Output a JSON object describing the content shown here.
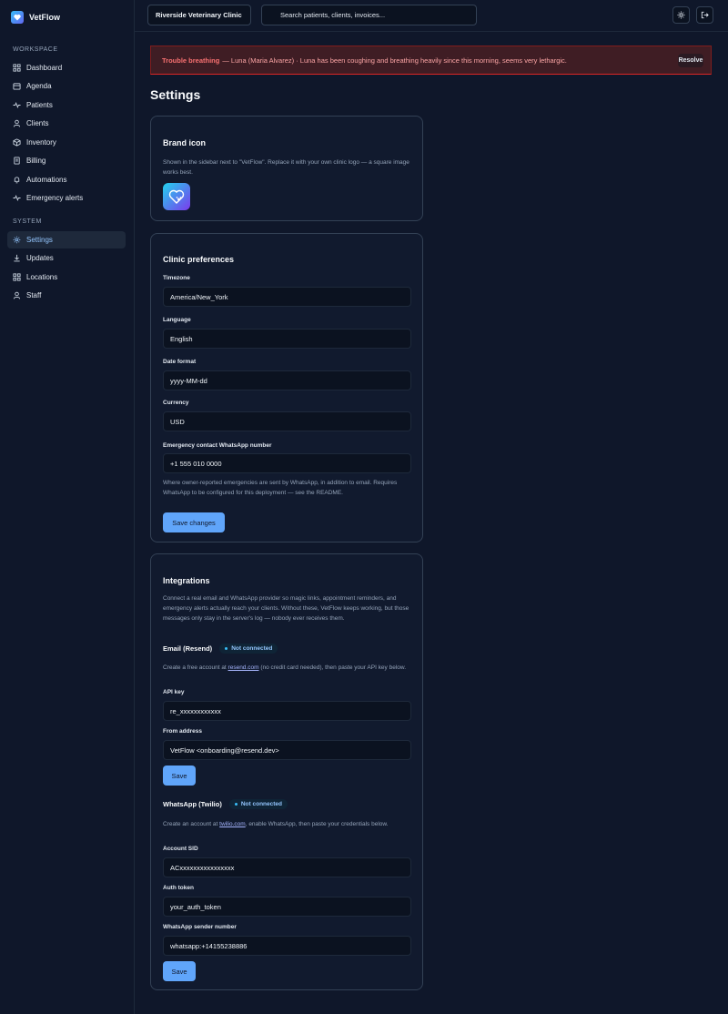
{
  "app": {
    "name": "VetFlow"
  },
  "sidebar": {
    "workspace_label": "WORKSPACE",
    "system_label": "SYSTEM",
    "workspace_items": [
      {
        "label": "Dashboard",
        "icon": "grid-icon"
      },
      {
        "label": "Agenda",
        "icon": "calendar-icon"
      },
      {
        "label": "Patients",
        "icon": "pulse-icon"
      },
      {
        "label": "Clients",
        "icon": "user-icon"
      },
      {
        "label": "Inventory",
        "icon": "box-icon"
      },
      {
        "label": "Billing",
        "icon": "receipt-icon"
      },
      {
        "label": "Automations",
        "icon": "bell-icon"
      },
      {
        "label": "Emergency alerts",
        "icon": "pulse-icon"
      }
    ],
    "system_items": [
      {
        "label": "Settings",
        "icon": "gear-icon",
        "active": true
      },
      {
        "label": "Updates",
        "icon": "download-icon"
      },
      {
        "label": "Locations",
        "icon": "grid-icon"
      },
      {
        "label": "Staff",
        "icon": "user-icon"
      }
    ]
  },
  "topbar": {
    "clinic": "Riverside Veterinary Clinic",
    "search_placeholder": "Search patients, clients, invoices..."
  },
  "alert": {
    "title": "Trouble breathing",
    "message": "— Luna (Maria Alvarez) · Luna has been coughing and breathing heavily since this morning, seems very lethargic.",
    "resolve_label": "Resolve"
  },
  "page": {
    "title": "Settings"
  },
  "brand_icon": {
    "title": "Brand icon",
    "description": "Shown in the sidebar next to \"VetFlow\". Replace it with your own clinic logo — a square image works best."
  },
  "clinic_prefs": {
    "title": "Clinic preferences",
    "timezone_label": "Timezone",
    "timezone_value": "America/New_York",
    "language_label": "Language",
    "language_value": "English",
    "date_format_label": "Date format",
    "date_format_value": "yyyy-MM-dd",
    "currency_label": "Currency",
    "currency_value": "USD",
    "whatsapp_label": "Emergency contact WhatsApp number",
    "whatsapp_value": "+1 555 010 0000",
    "whatsapp_help": "Where owner-reported emergencies are sent by WhatsApp, in addition to email. Requires WhatsApp to be configured for this deployment — see the README.",
    "save_label": "Save changes"
  },
  "integrations": {
    "title": "Integrations",
    "description": "Connect a real email and WhatsApp provider so magic links, appointment reminders, and emergency alerts actually reach your clients. Without these, VetFlow keeps working, but those messages only stay in the server's log — nobody ever receives them.",
    "email": {
      "name": "Email (Resend)",
      "status": "Not connected",
      "help_prefix": "Create a free account at ",
      "help_link": "resend.com",
      "help_suffix": " (no credit card needed), then paste your API key below.",
      "api_key_label": "API key",
      "api_key_value": "re_xxxxxxxxxxxx",
      "from_label": "From address",
      "from_value": "VetFlow <onboarding@resend.dev>",
      "save_label": "Save"
    },
    "whatsapp": {
      "name": "WhatsApp (Twilio)",
      "status": "Not connected",
      "help_prefix": "Create an account at ",
      "help_link": "twilio.com",
      "help_suffix": ", enable WhatsApp, then paste your credentials below.",
      "sid_label": "Account SID",
      "sid_value": "ACxxxxxxxxxxxxxxxx",
      "token_label": "Auth token",
      "token_value": "your_auth_token",
      "sender_label": "WhatsApp sender number",
      "sender_value": "whatsapp:+14155238886",
      "save_label": "Save"
    }
  }
}
